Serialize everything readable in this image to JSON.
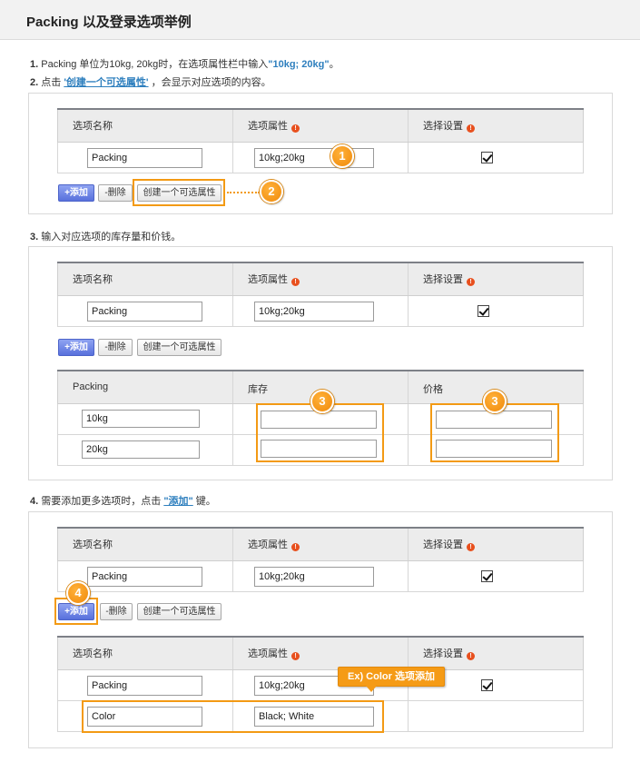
{
  "header": {
    "title": "Packing 以及登录选项举例"
  },
  "steps": {
    "s1_num": "1.",
    "s1_pre": " Packing 单位为10kg, 20kg时，在选项属性栏中输入",
    "s1_hl": "\"10kg; 20kg\"",
    "s1_post": "。",
    "s2_num": "2.",
    "s2_pre": " 点击 ",
    "s2_hl": "'创建一个可选属性'",
    "s2_post": " ，会显示对应选项的内容。",
    "s3_num": "3.",
    "s3_text": " 输入对应选项的库存量和价钱。",
    "s4_num": "4.",
    "s4_pre": " 需要添加更多选项时，点击 ",
    "s4_hl": "\"添加\"",
    "s4_post": " 键。"
  },
  "option_table": {
    "headers": {
      "name": "选项名称",
      "attr": "选项属性",
      "setting": "选择设置"
    },
    "row": {
      "name": "Packing",
      "attr": "10kg;20kg"
    },
    "info_mark": "!"
  },
  "buttons": {
    "add": "+添加",
    "delete": "-删除",
    "create": "创建一个可选属性"
  },
  "stock_table": {
    "headers": {
      "packing": "Packing",
      "stock": "库存",
      "price": "价格"
    },
    "rows": [
      "10kg",
      "20kg"
    ]
  },
  "section4": {
    "row2": {
      "name": "Color",
      "attr": "Black; White"
    },
    "callout": "Ex) Color 选项添加"
  },
  "badges": {
    "b1": "1",
    "b2": "2",
    "b3": "3",
    "b4": "4"
  },
  "colors": {
    "accent": "#f39a14",
    "link": "#2e7fbe",
    "add_button": "#5870dc",
    "info_dot": "#e8501e"
  }
}
